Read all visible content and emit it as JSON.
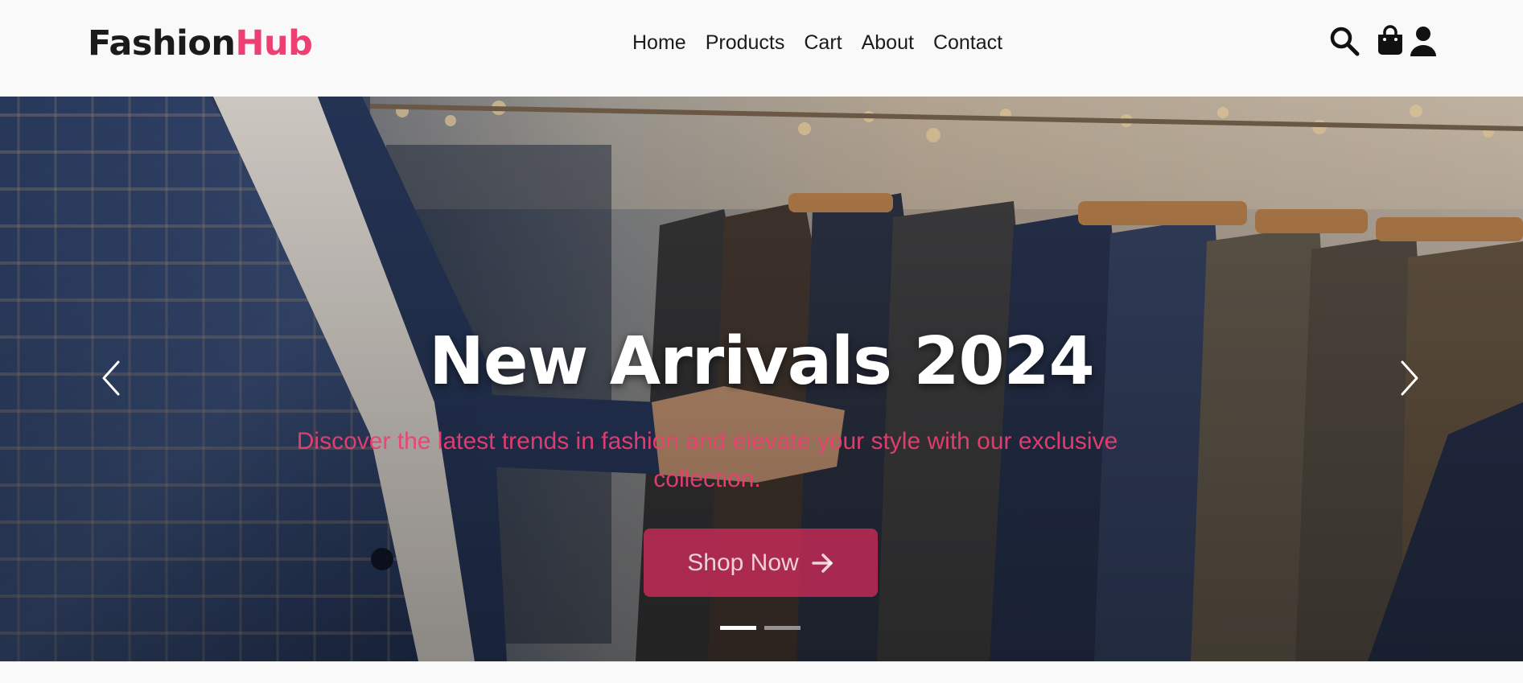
{
  "brand": {
    "name_part1": "Fashion",
    "name_part2": "Hub",
    "accent_color": "#ee3f72"
  },
  "nav": {
    "items": [
      {
        "label": "Home"
      },
      {
        "label": "Products"
      },
      {
        "label": "Cart"
      },
      {
        "label": "About"
      },
      {
        "label": "Contact"
      }
    ]
  },
  "header_icons": [
    "search-icon",
    "shopping-bag-icon",
    "user-icon"
  ],
  "hero": {
    "title": "New Arrivals 2024",
    "subtitle": "Discover the latest trends in fashion and elevate your style with our exclusive collection.",
    "cta_label": "Shop Now",
    "cta_icon": "arrow-right-icon",
    "prev_icon": "chevron-left-icon",
    "next_icon": "chevron-right-icon",
    "slide_count": 2,
    "active_slide": 1
  }
}
